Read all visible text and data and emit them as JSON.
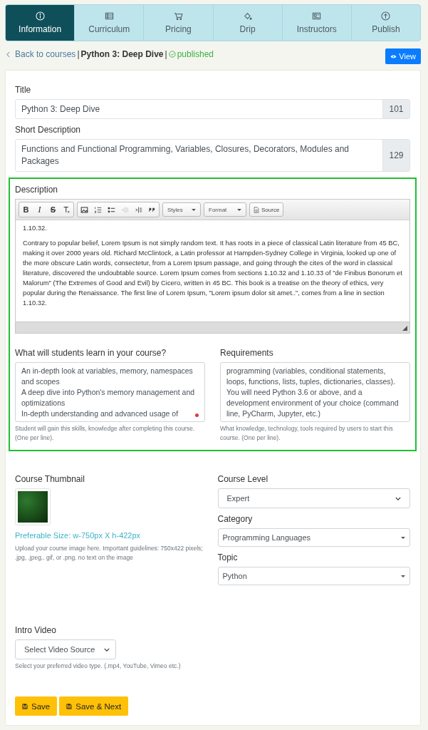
{
  "tabs": [
    {
      "label": "Information",
      "selected": true
    },
    {
      "label": "Curriculum",
      "selected": false
    },
    {
      "label": "Pricing",
      "selected": false
    },
    {
      "label": "Drip",
      "selected": false
    },
    {
      "label": "Instructors",
      "selected": false
    },
    {
      "label": "Publish",
      "selected": false
    }
  ],
  "breadcrumb": [
    {
      "kind": "link",
      "text": "Back to courses"
    },
    {
      "kind": "sep",
      "text": "|"
    },
    {
      "kind": "title",
      "text": "Python 3: Deep Dive"
    },
    {
      "kind": "sep",
      "text": "|"
    },
    {
      "kind": "status",
      "text": "published"
    }
  ],
  "view_button": "View",
  "title_field": {
    "label": "Title",
    "value": "Python 3: Deep Dive",
    "counter": "101"
  },
  "short_description": {
    "label": "Short Description",
    "value": "Functions and Functional Programming, Variables, Closures, Decorators, Modules and Packages",
    "counter": "129"
  },
  "description": {
    "label": "Description",
    "toolbar": [
      [
        {
          "kind": "bold",
          "label": "B",
          "disabled": false
        },
        {
          "kind": "italic",
          "label": "I",
          "disabled": false
        },
        {
          "kind": "strike",
          "label": "S",
          "disabled": false
        },
        {
          "kind": "remove-format",
          "disabled": false
        }
      ],
      [
        {
          "kind": "image",
          "disabled": false
        },
        {
          "kind": "numbered-list",
          "disabled": false
        },
        {
          "kind": "bulleted-list",
          "disabled": false
        },
        {
          "kind": "outdent",
          "disabled": true
        },
        {
          "kind": "indent",
          "disabled": false
        },
        {
          "kind": "blockquote",
          "disabled": false
        }
      ]
    ],
    "dropdowns": [
      "Styles",
      "Format"
    ],
    "source_button": "Source",
    "paragraphs": [
      "1.10.32.",
      "Contrary to popular belief, Lorem Ipsum is not simply random text. It has roots in a piece of classical Latin literature from 45 BC, making it over 2000 years old. Richard McClintock, a Latin professor at Hampden-Sydney College in Virginia, looked up one of the more obscure Latin words, consectetur, from a Lorem Ipsum passage, and going through the cites of the word in classical literature, discovered the undoubtable source. Lorem Ipsum comes from sections 1.10.32 and 1.10.33 of \"de Finibus Bonorum et Malorum\" (The Extremes of Good and Evil) by Cicero, written in 45 BC. This book is a treatise on the theory of ethics, very popular during the Renaissance. The first line of Lorem Ipsum, \"Lorem ipsum dolor sit amet..\", comes from a line in section 1.10.32."
    ]
  },
  "learn": {
    "label": "What will students learn in your course?",
    "lines": [
      "An in-depth look at variables, memory, namespaces and scopes",
      "A deep dive into Python's memory management and optimizations",
      "In-depth understanding and advanced usage of"
    ],
    "help": "Student will gain this skills, knowledge after completing this course. (One per line)."
  },
  "requirements": {
    "label": "Requirements",
    "lines": [
      "programming (variables, conditional statements, loops, functions, lists, tuples, dictionaries, classes).",
      "You will need Python 3.6 or above, and a development environment of your choice (command line, PyCharm, Jupyter, etc.)"
    ],
    "help": "What knowledge, technology, tools required by users to start this course. (One per line)."
  },
  "thumbnail": {
    "label": "Course Thumbnail",
    "size_link": "Preferable Size: w-750px X h-422px",
    "help": "Upload your course image here. Important guidelines: 750x422 pixels; .jpg, .jpeg,. gif, or .png. no text on the image"
  },
  "course_level": {
    "label": "Course Level",
    "value": "Expert"
  },
  "category": {
    "label": "Category",
    "value": "Programming Languages"
  },
  "topic": {
    "label": "Topic",
    "value": "Python"
  },
  "intro_video": {
    "label": "Intro Video",
    "value": "Select Video Source",
    "help": "Select your preferred video type. (.mp4, YouTube, Vimeo etc.)"
  },
  "buttons": [
    "Save",
    "Save & Next"
  ]
}
